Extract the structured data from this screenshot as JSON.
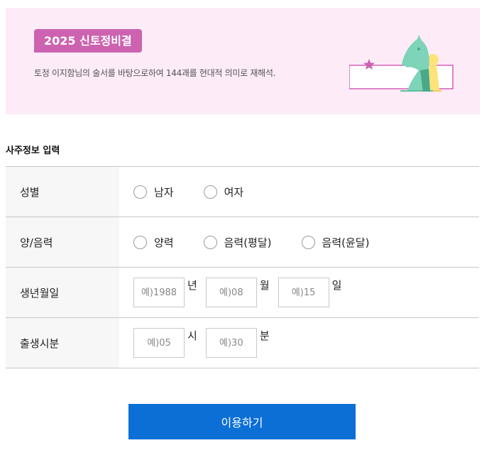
{
  "banner": {
    "badge": "2025 신토정비결",
    "description": "토정 이지함님의 술서를 바탕으로하여 144괘를 현대적 의미로 재해석."
  },
  "section_title": "사주정보 입력",
  "rows": {
    "gender": {
      "label": "성별",
      "options": [
        "남자",
        "여자"
      ]
    },
    "calendar": {
      "label": "양/음력",
      "options": [
        "양력",
        "음력(평달)",
        "음력(윤달)"
      ]
    },
    "birthdate": {
      "label": "생년월일",
      "year_placeholder": "예)1988",
      "year_unit": "년",
      "month_placeholder": "예)08",
      "month_unit": "월",
      "day_placeholder": "예)15",
      "day_unit": "일"
    },
    "birthtime": {
      "label": "출생시분",
      "hour_placeholder": "예)05",
      "hour_unit": "시",
      "minute_placeholder": "예)30",
      "minute_unit": "분"
    }
  },
  "submit_label": "이용하기",
  "colors": {
    "banner_bg": "#fdebf8",
    "badge": "#cc62b0",
    "primary": "#0b6fd6"
  },
  "icons": [
    "chess-knight-icon",
    "chess-pawn-icon",
    "star-icon"
  ]
}
